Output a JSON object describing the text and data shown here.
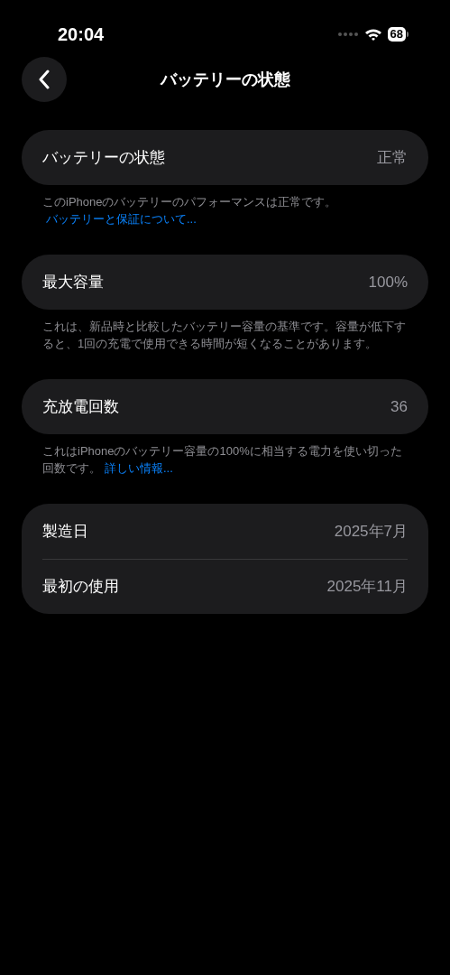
{
  "status_bar": {
    "time": "20:04",
    "battery": "68"
  },
  "nav": {
    "title": "バッテリーの状態"
  },
  "sections": [
    {
      "rows": [
        {
          "label": "バッテリーの状態",
          "value": "正常"
        }
      ],
      "footer": {
        "text": "このiPhoneのバッテリーのパフォーマンスは正常です。",
        "link": "バッテリーと保証について..."
      }
    },
    {
      "rows": [
        {
          "label": "最大容量",
          "value": "100%"
        }
      ],
      "footer": {
        "text": "これは、新品時と比較したバッテリー容量の基準です。容量が低下すると、1回の充電で使用できる時間が短くなることがあります。"
      }
    },
    {
      "rows": [
        {
          "label": "充放電回数",
          "value": "36"
        }
      ],
      "footer": {
        "text": "これはiPhoneのバッテリー容量の100%に相当する電力を使い切った回数です。",
        "link": "詳しい情報..."
      }
    },
    {
      "rows": [
        {
          "label": "製造日",
          "value": "2025年7月"
        },
        {
          "label": "最初の使用",
          "value": "2025年11月"
        }
      ]
    }
  ]
}
